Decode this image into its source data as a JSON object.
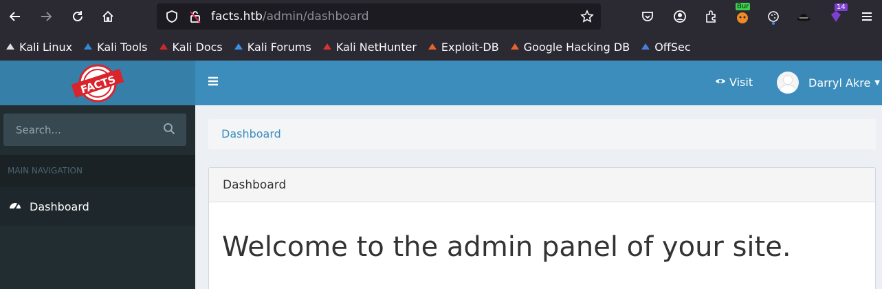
{
  "browser": {
    "url_host": "facts.htb",
    "url_path": "/admin/dashboard",
    "extension_badges": {
      "burp": "Bur",
      "count": "14"
    },
    "bookmarks": [
      {
        "label": "Kali Linux",
        "icon": "kali-dragon-icon",
        "color": "#e0e0e0"
      },
      {
        "label": "Kali Tools",
        "icon": "kali-tools-icon",
        "color": "#2e8bd6"
      },
      {
        "label": "Kali Docs",
        "icon": "kali-docs-icon",
        "color": "#d02828"
      },
      {
        "label": "Kali Forums",
        "icon": "kali-forums-icon",
        "color": "#3a8fe8"
      },
      {
        "label": "Kali NetHunter",
        "icon": "nethunter-icon",
        "color": "#d83232"
      },
      {
        "label": "Exploit-DB",
        "icon": "exploit-db-icon",
        "color": "#e8632b"
      },
      {
        "label": "Google Hacking DB",
        "icon": "ghdb-icon",
        "color": "#e8632b"
      },
      {
        "label": "OffSec",
        "icon": "offsec-icon",
        "color": "#4a7fd8"
      }
    ]
  },
  "app": {
    "logo_text": "FACTS",
    "header": {
      "visit_label": "Visit",
      "user_name": "Darryl Akre"
    },
    "sidebar": {
      "search_placeholder": "Search...",
      "nav_header": "MAIN NAVIGATION",
      "items": [
        {
          "label": "Dashboard",
          "icon": "dashboard-icon"
        }
      ]
    },
    "breadcrumb": "Dashboard",
    "box": {
      "title": "Dashboard",
      "welcome": "Welcome to the admin panel of your site."
    }
  }
}
